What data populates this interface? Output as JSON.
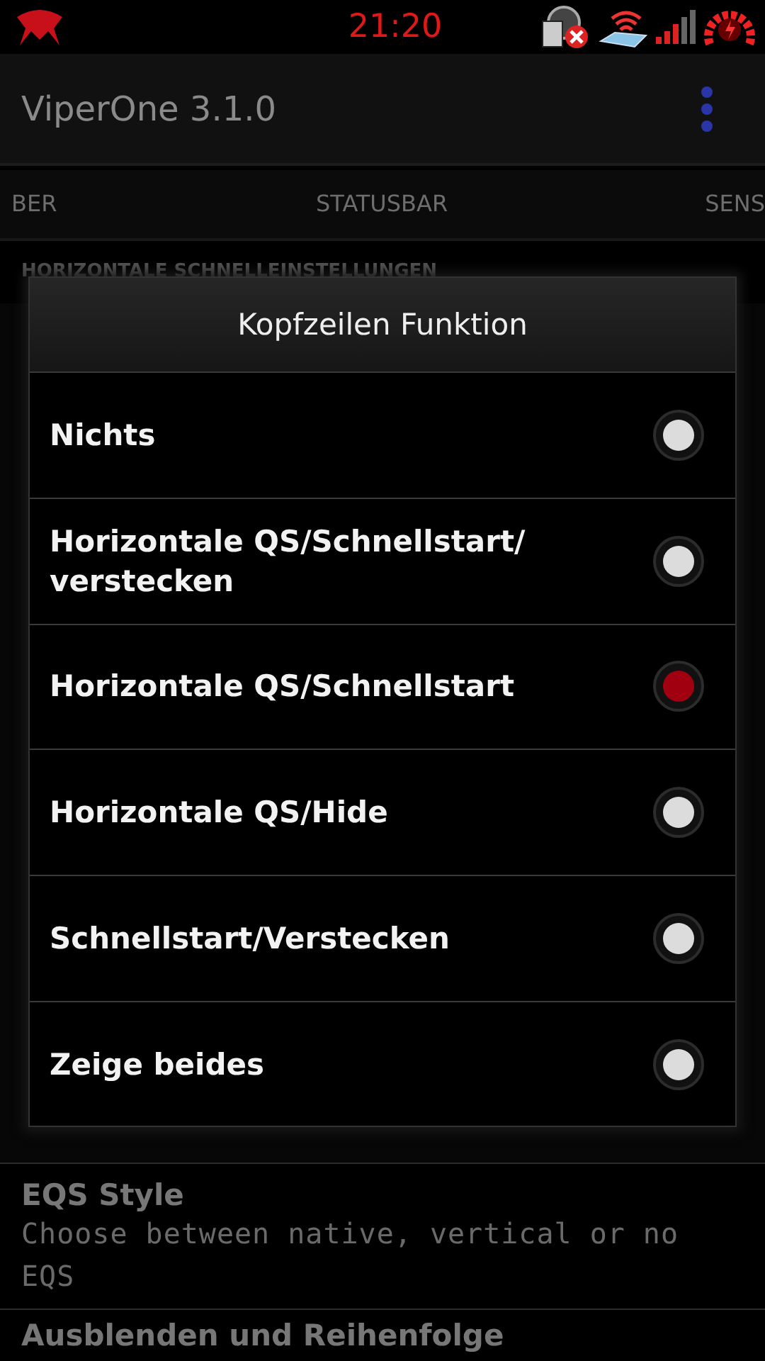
{
  "status_bar": {
    "time": "21:20"
  },
  "action_bar": {
    "title": "ViperOne 3.1.0"
  },
  "tabs": [
    {
      "label": "BER"
    },
    {
      "label": "STATUSBAR"
    },
    {
      "label": "SENS"
    }
  ],
  "section_header": "HORIZONTALE SCHNELLEINSTELLUNGEN",
  "dialog": {
    "title": "Kopfzeilen Funktion",
    "options": [
      {
        "label": "Nichts",
        "selected": false
      },
      {
        "label": "Horizontale QS/Schnellstart/ verstecken",
        "selected": false
      },
      {
        "label": "Horizontale QS/Schnellstart",
        "selected": true
      },
      {
        "label": "Horizontale QS/Hide",
        "selected": false
      },
      {
        "label": "Schnellstart/Verstecken",
        "selected": false
      },
      {
        "label": "Zeige beides",
        "selected": false
      }
    ]
  },
  "preferences": [
    {
      "title": "EQS Style",
      "summary": "Choose between native, vertical or no EQS"
    },
    {
      "title": "Ausblenden und Reihenfolge"
    }
  ]
}
